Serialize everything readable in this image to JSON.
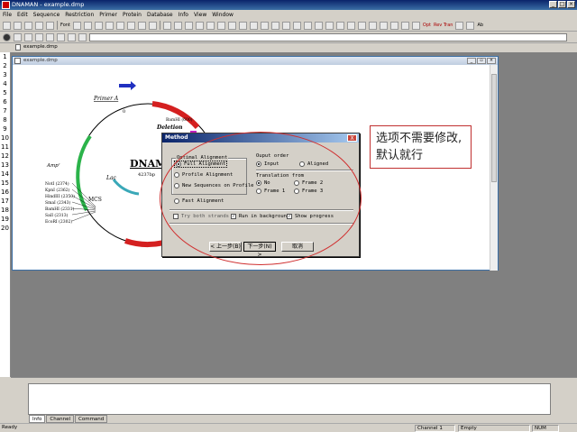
{
  "app": {
    "title": "DNAMAN - example.dmp"
  },
  "menu": [
    "File",
    "Edit",
    "Sequence",
    "Restriction",
    "Primer",
    "Protein",
    "Database",
    "Info",
    "View",
    "Window"
  ],
  "toolbar": {
    "labels": [
      "Font",
      "Opt",
      "Rev Tran",
      "Ab"
    ]
  },
  "document": {
    "tab_label": "example.dmp",
    "window_title": "example.dmp"
  },
  "gutter_numbers": [
    "1",
    "2",
    "3",
    "4",
    "5",
    "6",
    "7",
    "8",
    "9",
    "10",
    "11",
    "12",
    "13",
    "14",
    "15",
    "16",
    "17",
    "18",
    "19",
    "20"
  ],
  "plasmid": {
    "name": "DNAMAN",
    "size": "4237bp",
    "primer": "Primer A",
    "deletion": "Deletion",
    "ampr": "Ampʳ",
    "lac": "Lac",
    "mcs": "MCS",
    "zero": "0",
    "bamhi_top": "BamHI (600)",
    "sites": [
      "NotI (2374)",
      "KpnI (2362)",
      "HindIII (2350)",
      "SmaI (2343)",
      "BamHI (2331)",
      "SalI (2313)",
      "EcoRI (2302)"
    ]
  },
  "dialog": {
    "title": "Method",
    "close": "X",
    "optimal_group": "Optimal Alignment",
    "options": [
      "Full Alignment",
      "Profile Alignment",
      "New Sequences on Profile"
    ],
    "fast": "Fast Alignment",
    "output_group": "Ouput order",
    "output_options": [
      "Input",
      "Aligned"
    ],
    "translation_group": "Translation from",
    "translation_options": [
      "No",
      "Frame 2",
      "Frame 1",
      "Frame 3"
    ],
    "checks": [
      "Try both strands",
      "Run in background",
      "Show progress"
    ],
    "back": "< 上一步(B)",
    "next": "下一步(N) >",
    "cancel": "取消"
  },
  "callout": {
    "text": "选项不需要修改,默认就行"
  },
  "bottom_tabs": [
    "Info",
    "Channel",
    "Command"
  ],
  "status": {
    "ready": "Ready",
    "channel": "Channel 1",
    "empty": "Empty",
    "num": "NUM"
  },
  "colors": {
    "accent_red": "#d03030",
    "title_blue": "#0a246a"
  }
}
